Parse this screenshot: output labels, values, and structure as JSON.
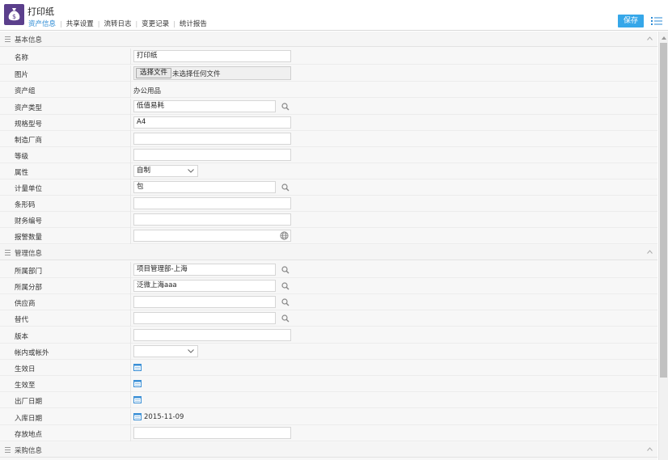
{
  "header": {
    "title": "打印纸",
    "tabs": [
      "资产信息",
      "共享设置",
      "流转日志",
      "变更记录",
      "统计报告"
    ],
    "save_label": "保存",
    "accent_color": "#36a7e9",
    "icon_color": "#5b3f8c"
  },
  "sections": {
    "basic": "基本信息",
    "management": "管理信息",
    "purchase": "采购信息"
  },
  "basic": {
    "name": {
      "label": "名称",
      "value": "打印纸"
    },
    "image": {
      "label": "图片",
      "button": "选择文件",
      "status": "未选择任何文件"
    },
    "group": {
      "label": "资产组",
      "value": "办公用品"
    },
    "type": {
      "label": "资产类型",
      "value": "低值易耗"
    },
    "spec": {
      "label": "规格型号",
      "value": "A4"
    },
    "manufacturer": {
      "label": "制造厂商",
      "value": ""
    },
    "grade": {
      "label": "等级",
      "value": ""
    },
    "attribute": {
      "label": "属性",
      "value": "自制"
    },
    "unit": {
      "label": "计量单位",
      "value": "包"
    },
    "barcode": {
      "label": "条形码",
      "value": ""
    },
    "finance_no": {
      "label": "财务编号",
      "value": ""
    },
    "alert_qty": {
      "label": "报警数量",
      "value": ""
    }
  },
  "management": {
    "department": {
      "label": "所属部门",
      "value": "项目管理部-上海"
    },
    "branch": {
      "label": "所属分部",
      "value": "泛微上海aaa"
    },
    "supplier": {
      "label": "供应商",
      "value": ""
    },
    "substitute": {
      "label": "替代",
      "value": ""
    },
    "version": {
      "label": "版本",
      "value": ""
    },
    "in_out": {
      "label": "帐内或帐外",
      "value": ""
    },
    "effective_date": {
      "label": "生效日",
      "value": ""
    },
    "expiry_date": {
      "label": "生效至",
      "value": ""
    },
    "factory_date": {
      "label": "出厂日期",
      "value": ""
    },
    "stock_date": {
      "label": "入库日期",
      "value": "2015-11-09"
    },
    "location": {
      "label": "存放地点",
      "value": ""
    }
  }
}
